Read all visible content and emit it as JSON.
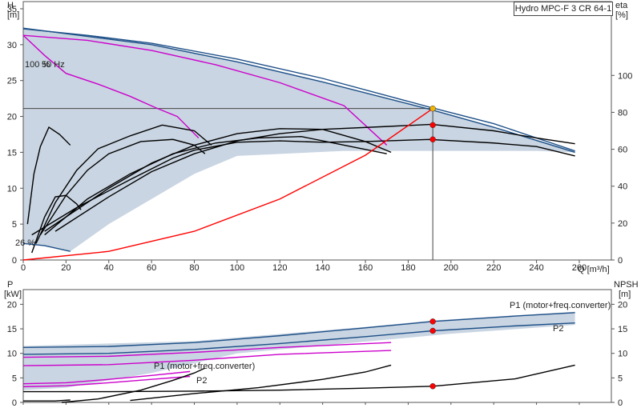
{
  "chart_data": [
    {
      "type": "line",
      "title": "Hydro MPC-F 3 CR 64-1",
      "left_axis": {
        "name": "H",
        "unit": "[m]",
        "ticks": [
          0,
          5,
          10,
          15,
          20,
          25,
          30,
          35
        ],
        "range": [
          0,
          36
        ]
      },
      "right_axis": {
        "name": "eta",
        "unit": "[%]",
        "ticks": [
          0,
          20,
          40,
          60,
          80,
          100
        ],
        "range": [
          0,
          140
        ]
      },
      "x_axis": {
        "name": "Q",
        "unit": "[m³/h]",
        "ticks": [
          0,
          20,
          40,
          60,
          80,
          100,
          120,
          140,
          160,
          180,
          200,
          220,
          240,
          260
        ],
        "range": [
          0,
          275
        ]
      },
      "annotations": {
        "speed": "100 %",
        "freq": "50 Hz",
        "min_speed": "26 %"
      },
      "operating_point": {
        "x": 191.5,
        "H": 21.1
      },
      "series": [
        {
          "color": "#1d4f87",
          "points": [
            [
              0,
              32.2
            ],
            [
              30,
              31.3
            ],
            [
              60,
              30.2
            ],
            [
              100,
              28
            ],
            [
              140,
              25.3
            ],
            [
              190,
              21.3
            ],
            [
              220,
              19
            ],
            [
              258,
              15.2
            ]
          ]
        },
        {
          "color": "#1d4f87",
          "points": [
            [
              0,
              32.3
            ],
            [
              60,
              30
            ],
            [
              100,
              27.6
            ],
            [
              140,
              24.8
            ],
            [
              190,
              21
            ],
            [
              220,
              18.5
            ],
            [
              258,
              15
            ]
          ]
        },
        {
          "color": "#cc00cc",
          "points": [
            [
              0,
              31.3
            ],
            [
              30,
              30.6
            ],
            [
              60,
              29.2
            ],
            [
              90,
              27.2
            ],
            [
              120,
              24.7
            ],
            [
              150,
              21.5
            ],
            [
              170,
              16
            ]
          ]
        },
        {
          "color": "#cc00cc",
          "points": [
            [
              0,
              31.3
            ],
            [
              10,
              28.5
            ],
            [
              20,
              26
            ],
            [
              35,
              24.5
            ],
            [
              50,
              22.8
            ],
            [
              62,
              21.2
            ],
            [
              72,
              20
            ],
            [
              82,
              17
            ]
          ]
        },
        {
          "color": "#000000",
          "points": [
            [
              4,
              3.5
            ],
            [
              25,
              7.3
            ],
            [
              50,
              11.2
            ],
            [
              70,
              14.2
            ],
            [
              80,
              15.3
            ],
            [
              100,
              16.4
            ],
            [
              120,
              16.6
            ],
            [
              140,
              16.4
            ],
            [
              160,
              16.5
            ],
            [
              190,
              16.8
            ],
            [
              220,
              16.3
            ],
            [
              240,
              15.8
            ],
            [
              258,
              14.5
            ]
          ]
        },
        {
          "color": "#000000",
          "points": [
            [
              15,
              4
            ],
            [
              40,
              8.8
            ],
            [
              60,
              12.3
            ],
            [
              80,
              14.8
            ],
            [
              100,
              16.6
            ],
            [
              120,
              17.6
            ],
            [
              140,
              18.2
            ],
            [
              170,
              18.6
            ],
            [
              191,
              18.9
            ],
            [
              220,
              18
            ],
            [
              240,
              17
            ],
            [
              258,
              16.2
            ]
          ]
        },
        {
          "color": "#000000",
          "points": [
            [
              8,
              3.5
            ],
            [
              20,
              9
            ],
            [
              30,
              12.5
            ],
            [
              40,
              14.8
            ],
            [
              55,
              16.5
            ],
            [
              70,
              16.8
            ],
            [
              80,
              16
            ],
            [
              85,
              14.8
            ]
          ]
        },
        {
          "color": "#000000",
          "points": [
            [
              6,
              2.3
            ],
            [
              15,
              8
            ],
            [
              25,
              12.5
            ],
            [
              35,
              15.5
            ],
            [
              50,
              17.3
            ],
            [
              65,
              18.8
            ],
            [
              80,
              18
            ],
            [
              88,
              16
            ]
          ]
        },
        {
          "color": "#000000",
          "points": [
            [
              4,
              1
            ],
            [
              10,
              6
            ],
            [
              15,
              8.8
            ],
            [
              20,
              9
            ],
            [
              25,
              7.8
            ],
            [
              27,
              7
            ]
          ]
        },
        {
          "color": "#000000",
          "points": [
            [
              2,
              5
            ],
            [
              5,
              12
            ],
            [
              8,
              15.8
            ],
            [
              12,
              18.5
            ],
            [
              17,
              17.5
            ],
            [
              22,
              16
            ]
          ]
        },
        {
          "color": "#000000",
          "points": [
            [
              10,
              3.5
            ],
            [
              30,
              8.5
            ],
            [
              50,
              12
            ],
            [
              70,
              14.8
            ],
            [
              90,
              16.3
            ],
            [
              110,
              17
            ],
            [
              130,
              17.2
            ],
            [
              150,
              16
            ],
            [
              170,
              14.8
            ]
          ]
        },
        {
          "color": "#000000",
          "points": [
            [
              10,
              4
            ],
            [
              40,
              10
            ],
            [
              60,
              13.5
            ],
            [
              80,
              16
            ],
            [
              100,
              17.6
            ],
            [
              120,
              18.3
            ],
            [
              140,
              18.2
            ],
            [
              160,
              16.5
            ],
            [
              172,
              15
            ]
          ]
        },
        {
          "color": "#1d4f87",
          "points": [
            [
              0,
              2.3
            ],
            [
              10,
              2
            ],
            [
              22,
              1.2
            ]
          ]
        },
        {
          "color": "#ff0000",
          "points": [
            [
              0,
              0
            ],
            [
              40,
              1.2
            ],
            [
              80,
              4
            ],
            [
              120,
              8.5
            ],
            [
              160,
              14.6
            ],
            [
              191.5,
              21.1
            ]
          ]
        }
      ],
      "markers": [
        [
          191.5,
          21.1,
          "#f0b400"
        ],
        [
          191.5,
          18.8,
          "#ff0000"
        ],
        [
          191.5,
          16.8,
          "#ff0000"
        ]
      ]
    },
    {
      "type": "line",
      "left_axis": {
        "name": "P",
        "unit": "[kW]",
        "ticks": [
          0,
          5,
          10,
          15,
          20
        ],
        "range": [
          0,
          23
        ]
      },
      "right_axis": {
        "name": "NPSH",
        "unit": "[m]",
        "ticks": [
          0,
          5,
          10,
          15,
          20
        ],
        "range": [
          0,
          23
        ]
      },
      "x_axis": {
        "range": [
          0,
          275
        ]
      },
      "labels": {
        "p1_right": "P1 (motor+freq.converter)",
        "p2_right": "P2",
        "p1_left": "P1 (motor+freq.converter)",
        "p2_left": "P2"
      },
      "series": [
        {
          "color": "#1d4f87",
          "points": [
            [
              0,
              11.2
            ],
            [
              40,
              11.4
            ],
            [
              80,
              12.2
            ],
            [
              120,
              13.6
            ],
            [
              160,
              15.2
            ],
            [
              191.5,
              16.5
            ],
            [
              230,
              17.6
            ],
            [
              258,
              18.3
            ]
          ]
        },
        {
          "color": "#1d4f87",
          "points": [
            [
              0,
              9.8
            ],
            [
              40,
              10
            ],
            [
              80,
              10.8
            ],
            [
              120,
              12
            ],
            [
              160,
              13.4
            ],
            [
              191.5,
              14.6
            ],
            [
              230,
              15.6
            ],
            [
              258,
              16.2
            ]
          ]
        },
        {
          "color": "#cc00cc",
          "points": [
            [
              0,
              9.2
            ],
            [
              40,
              9.4
            ],
            [
              80,
              10.2
            ],
            [
              120,
              11.2
            ],
            [
              172,
              12.2
            ]
          ]
        },
        {
          "color": "#cc00cc",
          "points": [
            [
              0,
              7.5
            ],
            [
              40,
              7.7
            ],
            [
              80,
              8.6
            ],
            [
              120,
              9.8
            ],
            [
              172,
              10.6
            ]
          ]
        },
        {
          "color": "#cc00cc",
          "points": [
            [
              0,
              3.8
            ],
            [
              20,
              4
            ],
            [
              40,
              4.7
            ],
            [
              60,
              5.5
            ],
            [
              78,
              6.3
            ]
          ]
        },
        {
          "color": "#cc00cc",
          "points": [
            [
              0,
              3.2
            ],
            [
              20,
              3.4
            ],
            [
              40,
              4
            ],
            [
              60,
              4.7
            ],
            [
              78,
              5.3
            ]
          ]
        },
        {
          "color": "#000000",
          "points": [
            [
              0,
              2.2
            ],
            [
              40,
              2.2
            ],
            [
              80,
              2.3
            ],
            [
              120,
              2.5
            ],
            [
              160,
              2.9
            ],
            [
              191.5,
              3.3
            ],
            [
              230,
              4.8
            ],
            [
              258,
              7.6
            ]
          ]
        },
        {
          "color": "#000000",
          "points": [
            [
              18,
              0
            ],
            [
              35,
              0.7
            ],
            [
              55,
              2.5
            ],
            [
              70,
              4.5
            ],
            [
              80,
              6
            ],
            [
              85,
              7
            ]
          ]
        },
        {
          "color": "#000000",
          "points": [
            [
              50,
              0.4
            ],
            [
              80,
              1.8
            ],
            [
              110,
              3
            ],
            [
              140,
              4.7
            ],
            [
              160,
              6.2
            ],
            [
              172,
              7.6
            ]
          ]
        },
        {
          "color": "#000000",
          "points": [
            [
              0,
              0.3
            ],
            [
              15,
              0.3
            ],
            [
              22,
              0.5
            ]
          ]
        }
      ],
      "markers": [
        [
          191.5,
          16.5,
          "#ff0000"
        ],
        [
          191.5,
          14.6,
          "#ff0000"
        ],
        [
          191.5,
          3.3,
          "#ff0000"
        ]
      ]
    }
  ]
}
